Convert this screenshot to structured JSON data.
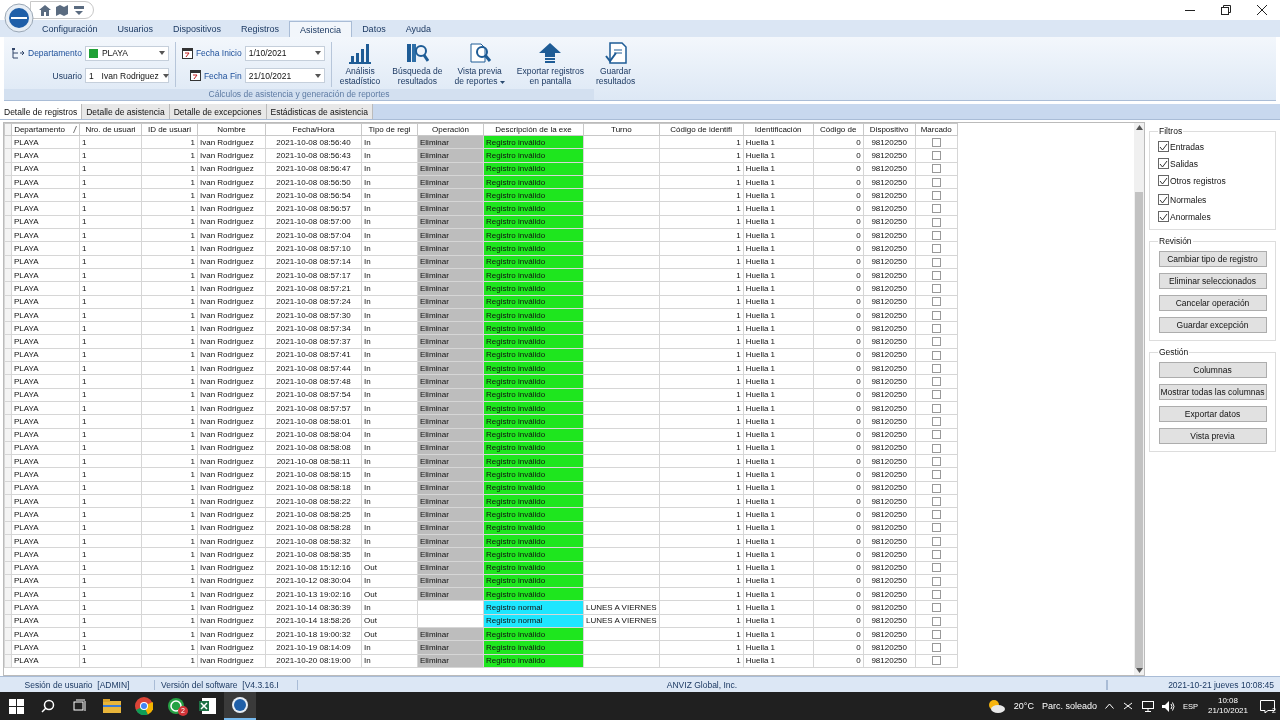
{
  "menu_tabs": [
    {
      "label": "Configuración",
      "selected": false
    },
    {
      "label": "Usuarios",
      "selected": false
    },
    {
      "label": "Dispositivos",
      "selected": false
    },
    {
      "label": "Registros",
      "selected": false
    },
    {
      "label": "Asistencia",
      "selected": true
    },
    {
      "label": "Datos",
      "selected": false
    },
    {
      "label": "Ayuda",
      "selected": false
    }
  ],
  "ribbon": {
    "filters": [
      {
        "label": "Departamento",
        "value": "PLAYA",
        "color": "#1fa035"
      },
      {
        "label": "Usuario",
        "number": "1",
        "value": "Ivan Rodriguez"
      }
    ],
    "dates": [
      {
        "label": "Fecha Inicio",
        "value": "1/10/2021"
      },
      {
        "label": "Fecha Fin",
        "value": "21/10/2021"
      }
    ],
    "buttons": [
      {
        "kind": "chart",
        "lines": [
          "Análisis",
          "estadístico"
        ],
        "dropdown": false
      },
      {
        "kind": "search",
        "lines": [
          "Búsqueda de",
          "resultados"
        ],
        "dropdown": false
      },
      {
        "kind": "preview",
        "lines": [
          "Vista previa",
          "de reportes"
        ],
        "dropdown": true
      },
      {
        "kind": "export",
        "lines": [
          "Exportar registros",
          "en pantalla"
        ],
        "dropdown": false
      },
      {
        "kind": "save",
        "lines": [
          "Guardar",
          "resultados"
        ],
        "dropdown": false
      }
    ],
    "group_label": "Cálculos de asistencia y generación de reportes"
  },
  "view_tabs": [
    {
      "label": "Detalle de registros",
      "selected": true
    },
    {
      "label": "Detalle de asistencia",
      "selected": false
    },
    {
      "label": "Detalle de excepciones",
      "selected": false
    },
    {
      "label": "Estádisticas de asistencia",
      "selected": false
    }
  ],
  "table": {
    "columns": [
      "Departamento",
      "Nro. de usuari",
      "ID de usuari",
      "Nombre",
      "Fecha/Hora",
      "Tipo de regi",
      "Operación",
      "Descripción de la exe",
      "Turno",
      "Código de identifi",
      "Identificación",
      "Código de",
      "Dispositivo",
      "Marcado"
    ],
    "rows": [
      {
        "dept": "PLAYA",
        "user_no": "1",
        "user_id": "1",
        "name": "Ivan Rodriguez",
        "datetime": "2021-10-08 08:56:40",
        "type": "In",
        "operation": "Eliminar",
        "description": "Registro inválido",
        "invalid": true,
        "ident_code": "1",
        "identification": "Huella 1",
        "code": "0",
        "device": "98120250",
        "checked": false
      },
      {
        "dept": "PLAYA",
        "user_no": "1",
        "user_id": "1",
        "name": "Ivan Rodriguez",
        "datetime": "2021-10-08 08:56:43",
        "type": "In",
        "operation": "Eliminar",
        "description": "Registro inválido",
        "invalid": true,
        "ident_code": "1",
        "identification": "Huella 1",
        "code": "0",
        "device": "98120250",
        "checked": false
      },
      {
        "dept": "PLAYA",
        "user_no": "1",
        "user_id": "1",
        "name": "Ivan Rodriguez",
        "datetime": "2021-10-08 08:56:47",
        "type": "In",
        "operation": "Eliminar",
        "description": "Registro inválido",
        "invalid": true,
        "ident_code": "1",
        "identification": "Huella 1",
        "code": "0",
        "device": "98120250",
        "checked": false
      },
      {
        "dept": "PLAYA",
        "user_no": "1",
        "user_id": "1",
        "name": "Ivan Rodriguez",
        "datetime": "2021-10-08 08:56:50",
        "type": "In",
        "operation": "Eliminar",
        "description": "Registro inválido",
        "invalid": true,
        "ident_code": "1",
        "identification": "Huella 1",
        "code": "0",
        "device": "98120250",
        "checked": false
      },
      {
        "dept": "PLAYA",
        "user_no": "1",
        "user_id": "1",
        "name": "Ivan Rodriguez",
        "datetime": "2021-10-08 08:56:54",
        "type": "In",
        "operation": "Eliminar",
        "description": "Registro inválido",
        "invalid": true,
        "ident_code": "1",
        "identification": "Huella 1",
        "code": "0",
        "device": "98120250",
        "checked": false
      },
      {
        "dept": "PLAYA",
        "user_no": "1",
        "user_id": "1",
        "name": "Ivan Rodriguez",
        "datetime": "2021-10-08 08:56:57",
        "type": "In",
        "operation": "Eliminar",
        "description": "Registro inválido",
        "invalid": true,
        "ident_code": "1",
        "identification": "Huella 1",
        "code": "0",
        "device": "98120250",
        "checked": false
      },
      {
        "dept": "PLAYA",
        "user_no": "1",
        "user_id": "1",
        "name": "Ivan Rodriguez",
        "datetime": "2021-10-08 08:57:00",
        "type": "In",
        "operation": "Eliminar",
        "description": "Registro inválido",
        "invalid": true,
        "ident_code": "1",
        "identification": "Huella 1",
        "code": "0",
        "device": "98120250",
        "checked": false
      },
      {
        "dept": "PLAYA",
        "user_no": "1",
        "user_id": "1",
        "name": "Ivan Rodriguez",
        "datetime": "2021-10-08 08:57:04",
        "type": "In",
        "operation": "Eliminar",
        "description": "Registro inválido",
        "invalid": true,
        "ident_code": "1",
        "identification": "Huella 1",
        "code": "0",
        "device": "98120250",
        "checked": false
      },
      {
        "dept": "PLAYA",
        "user_no": "1",
        "user_id": "1",
        "name": "Ivan Rodriguez",
        "datetime": "2021-10-08 08:57:10",
        "type": "In",
        "operation": "Eliminar",
        "description": "Registro inválido",
        "invalid": true,
        "ident_code": "1",
        "identification": "Huella 1",
        "code": "0",
        "device": "98120250",
        "checked": false
      },
      {
        "dept": "PLAYA",
        "user_no": "1",
        "user_id": "1",
        "name": "Ivan Rodriguez",
        "datetime": "2021-10-08 08:57:14",
        "type": "In",
        "operation": "Eliminar",
        "description": "Registro inválido",
        "invalid": true,
        "ident_code": "1",
        "identification": "Huella 1",
        "code": "0",
        "device": "98120250",
        "checked": false
      },
      {
        "dept": "PLAYA",
        "user_no": "1",
        "user_id": "1",
        "name": "Ivan Rodriguez",
        "datetime": "2021-10-08 08:57:17",
        "type": "In",
        "operation": "Eliminar",
        "description": "Registro inválido",
        "invalid": true,
        "ident_code": "1",
        "identification": "Huella 1",
        "code": "0",
        "device": "98120250",
        "checked": false
      },
      {
        "dept": "PLAYA",
        "user_no": "1",
        "user_id": "1",
        "name": "Ivan Rodriguez",
        "datetime": "2021-10-08 08:57:21",
        "type": "In",
        "operation": "Eliminar",
        "description": "Registro inválido",
        "invalid": true,
        "ident_code": "1",
        "identification": "Huella 1",
        "code": "0",
        "device": "98120250",
        "checked": false
      },
      {
        "dept": "PLAYA",
        "user_no": "1",
        "user_id": "1",
        "name": "Ivan Rodriguez",
        "datetime": "2021-10-08 08:57:24",
        "type": "In",
        "operation": "Eliminar",
        "description": "Registro inválido",
        "invalid": true,
        "ident_code": "1",
        "identification": "Huella 1",
        "code": "0",
        "device": "98120250",
        "checked": false
      },
      {
        "dept": "PLAYA",
        "user_no": "1",
        "user_id": "1",
        "name": "Ivan Rodriguez",
        "datetime": "2021-10-08 08:57:30",
        "type": "In",
        "operation": "Eliminar",
        "description": "Registro inválido",
        "invalid": true,
        "ident_code": "1",
        "identification": "Huella 1",
        "code": "0",
        "device": "98120250",
        "checked": false
      },
      {
        "dept": "PLAYA",
        "user_no": "1",
        "user_id": "1",
        "name": "Ivan Rodriguez",
        "datetime": "2021-10-08 08:57:34",
        "type": "In",
        "operation": "Eliminar",
        "description": "Registro inválido",
        "invalid": true,
        "ident_code": "1",
        "identification": "Huella 1",
        "code": "0",
        "device": "98120250",
        "checked": false
      },
      {
        "dept": "PLAYA",
        "user_no": "1",
        "user_id": "1",
        "name": "Ivan Rodriguez",
        "datetime": "2021-10-08 08:57:37",
        "type": "In",
        "operation": "Eliminar",
        "description": "Registro inválido",
        "invalid": true,
        "ident_code": "1",
        "identification": "Huella 1",
        "code": "0",
        "device": "98120250",
        "checked": false
      },
      {
        "dept": "PLAYA",
        "user_no": "1",
        "user_id": "1",
        "name": "Ivan Rodriguez",
        "datetime": "2021-10-08 08:57:41",
        "type": "In",
        "operation": "Eliminar",
        "description": "Registro inválido",
        "invalid": true,
        "ident_code": "1",
        "identification": "Huella 1",
        "code": "0",
        "device": "98120250",
        "checked": false
      },
      {
        "dept": "PLAYA",
        "user_no": "1",
        "user_id": "1",
        "name": "Ivan Rodriguez",
        "datetime": "2021-10-08 08:57:44",
        "type": "In",
        "operation": "Eliminar",
        "description": "Registro inválido",
        "invalid": true,
        "ident_code": "1",
        "identification": "Huella 1",
        "code": "0",
        "device": "98120250",
        "checked": false
      },
      {
        "dept": "PLAYA",
        "user_no": "1",
        "user_id": "1",
        "name": "Ivan Rodriguez",
        "datetime": "2021-10-08 08:57:48",
        "type": "In",
        "operation": "Eliminar",
        "description": "Registro inválido",
        "invalid": true,
        "ident_code": "1",
        "identification": "Huella 1",
        "code": "0",
        "device": "98120250",
        "checked": false
      },
      {
        "dept": "PLAYA",
        "user_no": "1",
        "user_id": "1",
        "name": "Ivan Rodriguez",
        "datetime": "2021-10-08 08:57:54",
        "type": "In",
        "operation": "Eliminar",
        "description": "Registro inválido",
        "invalid": true,
        "ident_code": "1",
        "identification": "Huella 1",
        "code": "0",
        "device": "98120250",
        "checked": false
      },
      {
        "dept": "PLAYA",
        "user_no": "1",
        "user_id": "1",
        "name": "Ivan Rodriguez",
        "datetime": "2021-10-08 08:57:57",
        "type": "In",
        "operation": "Eliminar",
        "description": "Registro inválido",
        "invalid": true,
        "ident_code": "1",
        "identification": "Huella 1",
        "code": "0",
        "device": "98120250",
        "checked": false
      },
      {
        "dept": "PLAYA",
        "user_no": "1",
        "user_id": "1",
        "name": "Ivan Rodriguez",
        "datetime": "2021-10-08 08:58:01",
        "type": "In",
        "operation": "Eliminar",
        "description": "Registro inválido",
        "invalid": true,
        "ident_code": "1",
        "identification": "Huella 1",
        "code": "0",
        "device": "98120250",
        "checked": false
      },
      {
        "dept": "PLAYA",
        "user_no": "1",
        "user_id": "1",
        "name": "Ivan Rodriguez",
        "datetime": "2021-10-08 08:58:04",
        "type": "In",
        "operation": "Eliminar",
        "description": "Registro inválido",
        "invalid": true,
        "ident_code": "1",
        "identification": "Huella 1",
        "code": "0",
        "device": "98120250",
        "checked": false
      },
      {
        "dept": "PLAYA",
        "user_no": "1",
        "user_id": "1",
        "name": "Ivan Rodriguez",
        "datetime": "2021-10-08 08:58:08",
        "type": "In",
        "operation": "Eliminar",
        "description": "Registro inválido",
        "invalid": true,
        "ident_code": "1",
        "identification": "Huella 1",
        "code": "0",
        "device": "98120250",
        "checked": false
      },
      {
        "dept": "PLAYA",
        "user_no": "1",
        "user_id": "1",
        "name": "Ivan Rodriguez",
        "datetime": "2021-10-08 08:58:11",
        "type": "In",
        "operation": "Eliminar",
        "description": "Registro inválido",
        "invalid": true,
        "ident_code": "1",
        "identification": "Huella 1",
        "code": "0",
        "device": "98120250",
        "checked": false
      },
      {
        "dept": "PLAYA",
        "user_no": "1",
        "user_id": "1",
        "name": "Ivan Rodriguez",
        "datetime": "2021-10-08 08:58:15",
        "type": "In",
        "operation": "Eliminar",
        "description": "Registro inválido",
        "invalid": true,
        "ident_code": "1",
        "identification": "Huella 1",
        "code": "0",
        "device": "98120250",
        "checked": false
      },
      {
        "dept": "PLAYA",
        "user_no": "1",
        "user_id": "1",
        "name": "Ivan Rodriguez",
        "datetime": "2021-10-08 08:58:18",
        "type": "In",
        "operation": "Eliminar",
        "description": "Registro inválido",
        "invalid": true,
        "ident_code": "1",
        "identification": "Huella 1",
        "code": "0",
        "device": "98120250",
        "checked": false
      },
      {
        "dept": "PLAYA",
        "user_no": "1",
        "user_id": "1",
        "name": "Ivan Rodriguez",
        "datetime": "2021-10-08 08:58:22",
        "type": "In",
        "operation": "Eliminar",
        "description": "Registro inválido",
        "invalid": true,
        "ident_code": "1",
        "identification": "Huella 1",
        "code": "0",
        "device": "98120250",
        "checked": false
      },
      {
        "dept": "PLAYA",
        "user_no": "1",
        "user_id": "1",
        "name": "Ivan Rodriguez",
        "datetime": "2021-10-08 08:58:25",
        "type": "In",
        "operation": "Eliminar",
        "description": "Registro inválido",
        "invalid": true,
        "ident_code": "1",
        "identification": "Huella 1",
        "code": "0",
        "device": "98120250",
        "checked": false
      },
      {
        "dept": "PLAYA",
        "user_no": "1",
        "user_id": "1",
        "name": "Ivan Rodriguez",
        "datetime": "2021-10-08 08:58:28",
        "type": "In",
        "operation": "Eliminar",
        "description": "Registro inválido",
        "invalid": true,
        "ident_code": "1",
        "identification": "Huella 1",
        "code": "0",
        "device": "98120250",
        "checked": false
      },
      {
        "dept": "PLAYA",
        "user_no": "1",
        "user_id": "1",
        "name": "Ivan Rodriguez",
        "datetime": "2021-10-08 08:58:32",
        "type": "In",
        "operation": "Eliminar",
        "description": "Registro inválido",
        "invalid": true,
        "ident_code": "1",
        "identification": "Huella 1",
        "code": "0",
        "device": "98120250",
        "checked": false
      },
      {
        "dept": "PLAYA",
        "user_no": "1",
        "user_id": "1",
        "name": "Ivan Rodriguez",
        "datetime": "2021-10-08 08:58:35",
        "type": "In",
        "operation": "Eliminar",
        "description": "Registro inválido",
        "invalid": true,
        "ident_code": "1",
        "identification": "Huella 1",
        "code": "0",
        "device": "98120250",
        "checked": false
      },
      {
        "dept": "PLAYA",
        "user_no": "1",
        "user_id": "1",
        "name": "Ivan Rodriguez",
        "datetime": "2021-10-08 15:12:16",
        "type": "Out",
        "operation": "Eliminar",
        "description": "Registro inválido",
        "invalid": true,
        "ident_code": "1",
        "identification": "Huella 1",
        "code": "0",
        "device": "98120250",
        "checked": false
      },
      {
        "dept": "PLAYA",
        "user_no": "1",
        "user_id": "1",
        "name": "Ivan Rodriguez",
        "datetime": "2021-10-12 08:30:04",
        "type": "In",
        "operation": "Eliminar",
        "description": "Registro inválido",
        "invalid": true,
        "ident_code": "1",
        "identification": "Huella 1",
        "code": "0",
        "device": "98120250",
        "checked": false
      },
      {
        "dept": "PLAYA",
        "user_no": "1",
        "user_id": "1",
        "name": "Ivan Rodriguez",
        "datetime": "2021-10-13 19:02:16",
        "type": "Out",
        "operation": "Eliminar",
        "description": "Registro inválido",
        "invalid": true,
        "ident_code": "1",
        "identification": "Huella 1",
        "code": "0",
        "device": "98120250",
        "checked": false
      },
      {
        "dept": "PLAYA",
        "user_no": "1",
        "user_id": "1",
        "name": "Ivan Rodriguez",
        "datetime": "2021-10-14 08:36:39",
        "type": "In",
        "description": "Registro normal",
        "invalid": false,
        "shift": "LUNES A VIERNES",
        "ident_code": "1",
        "identification": "Huella 1",
        "code": "0",
        "device": "98120250",
        "checked": false
      },
      {
        "dept": "PLAYA",
        "user_no": "1",
        "user_id": "1",
        "name": "Ivan Rodriguez",
        "datetime": "2021-10-14 18:58:26",
        "type": "Out",
        "description": "Registro normal",
        "invalid": false,
        "shift": "LUNES A VIERNES",
        "ident_code": "1",
        "identification": "Huella 1",
        "code": "0",
        "device": "98120250",
        "checked": false
      },
      {
        "dept": "PLAYA",
        "user_no": "1",
        "user_id": "1",
        "name": "Ivan Rodriguez",
        "datetime": "2021-10-18 19:00:32",
        "type": "Out",
        "operation": "Eliminar",
        "description": "Registro inválido",
        "invalid": true,
        "ident_code": "1",
        "identification": "Huella 1",
        "code": "0",
        "device": "98120250",
        "checked": false
      },
      {
        "dept": "PLAYA",
        "user_no": "1",
        "user_id": "1",
        "name": "Ivan Rodriguez",
        "datetime": "2021-10-19 08:14:09",
        "type": "In",
        "operation": "Eliminar",
        "description": "Registro inválido",
        "invalid": true,
        "ident_code": "1",
        "identification": "Huella 1",
        "code": "0",
        "device": "98120250",
        "checked": false
      },
      {
        "dept": "PLAYA",
        "user_no": "1",
        "user_id": "1",
        "name": "Ivan Rodriguez",
        "datetime": "2021-10-20 08:19:00",
        "type": "In",
        "operation": "Eliminar",
        "description": "Registro inválido",
        "invalid": true,
        "ident_code": "1",
        "identification": "Huella 1",
        "code": "0",
        "device": "98120250",
        "checked": false
      }
    ]
  },
  "filters": {
    "title": "Filtros",
    "items": [
      {
        "label": "Entradas",
        "checked": true
      },
      {
        "label": "Salidas",
        "checked": true
      },
      {
        "label": "Otros registros",
        "checked": true
      },
      {
        "label": "Normales",
        "checked": true
      },
      {
        "label": "Anormales",
        "checked": true
      }
    ]
  },
  "revision": {
    "title": "Revisión",
    "buttons": [
      "Cambiar tipo de registro",
      "Eliminar seleccionados",
      "Cancelar operación",
      "Guardar excepción"
    ]
  },
  "gestion": {
    "title": "Gestión",
    "buttons": [
      "Columnas",
      "Mostrar todas las columnas",
      "Exportar datos",
      "Vista previa"
    ]
  },
  "status_bar": [
    "Sesión de usuario  [ADMIN]",
    "Versión del software  [V4.3.16.I",
    "ANVIZ Global, Inc.",
    "2021-10-21 jueves 10:08:45"
  ],
  "taskbar": {
    "chat_badge": "2",
    "temperature": "20°C",
    "weather": "Parc. soleado",
    "language": "ESP",
    "time": "10:08",
    "date": "21/10/2021",
    "notifications": "2"
  }
}
